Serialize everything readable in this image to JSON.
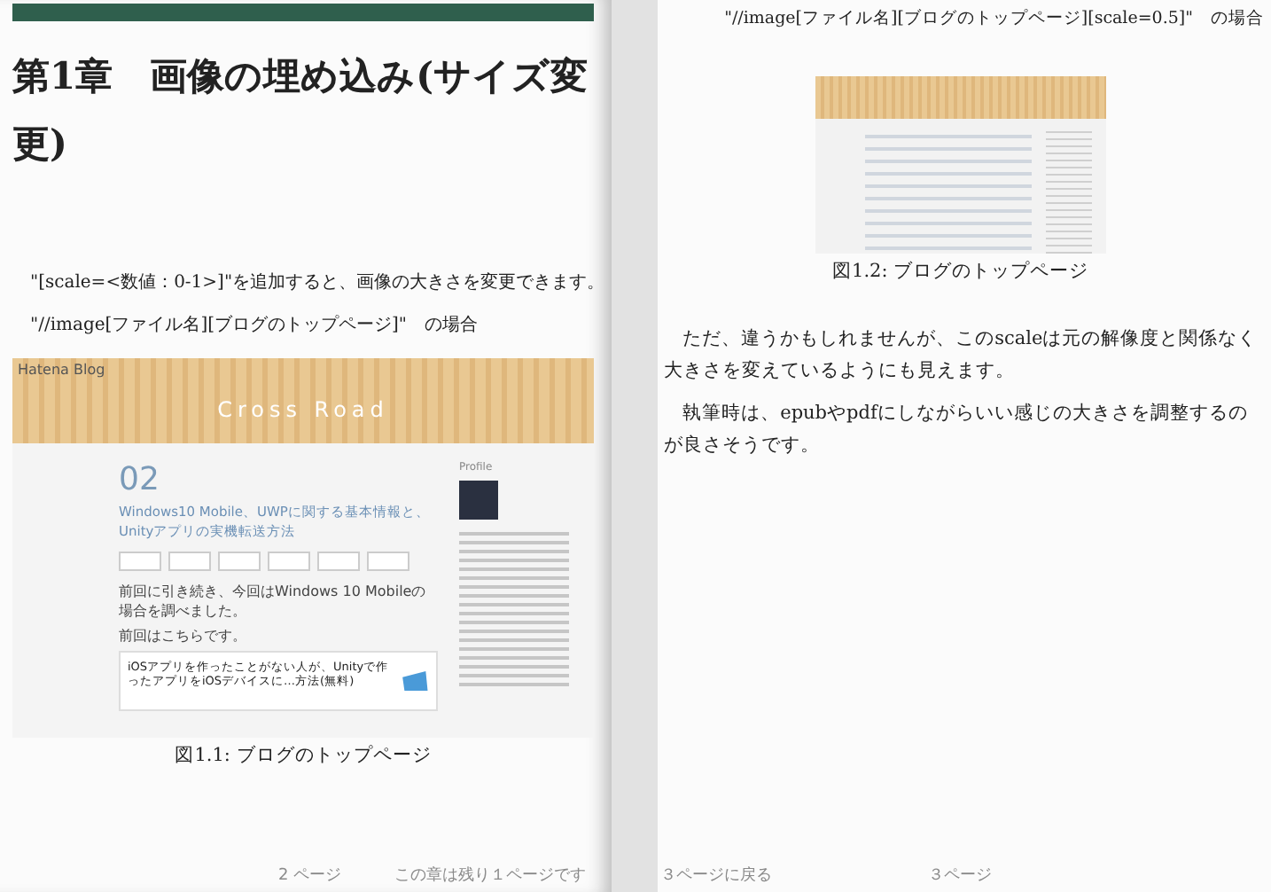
{
  "left_page": {
    "heading": "第1章　画像の埋め込み(サイズ変更)",
    "paragraphs": [
      "\"[scale=<数値：0-1>]\"を追加すると、画像の大きさを変更できます。",
      "\"//image[ファイル名][ブログのトップページ]\"　の場合"
    ],
    "figure": {
      "screenshot": {
        "brand": "Hatena Blog",
        "blog_title": "Cross Road",
        "day": "02",
        "post_title": "Windows10 Mobile、UWPに関する基本情報と、Unityアプリの実機転送方法",
        "body": [
          "前回に引き続き、今回はWindows 10 Mobileの場合を調べました。",
          "前回はこちらです。"
        ],
        "card_title": "iOSアプリを作ったことがない人が、Unityで作ったアプリをiOSデバイスに…方法(無料)",
        "sidebar_heading": "Profile"
      },
      "caption": "図1.1: ブログのトップページ"
    },
    "footer": [
      "2 ページ",
      "この章は残り１ページです"
    ]
  },
  "right_page": {
    "paragraphs_top": [
      "\"//image[ファイル名][ブログのトップページ][scale=0.5]\"　の場合"
    ],
    "figure": {
      "caption": "図1.2: ブログのトップページ"
    },
    "paragraphs": [
      "ただ、違うかもしれませんが、このscaleは元の解像度と関係なく大きさを変えているようにも見えます。",
      "執筆時は、epubやpdfにしながらいい感じの大きさを調整するのが良さそうです。"
    ],
    "footer": [
      "３ページに戻る",
      "３ページ"
    ]
  }
}
